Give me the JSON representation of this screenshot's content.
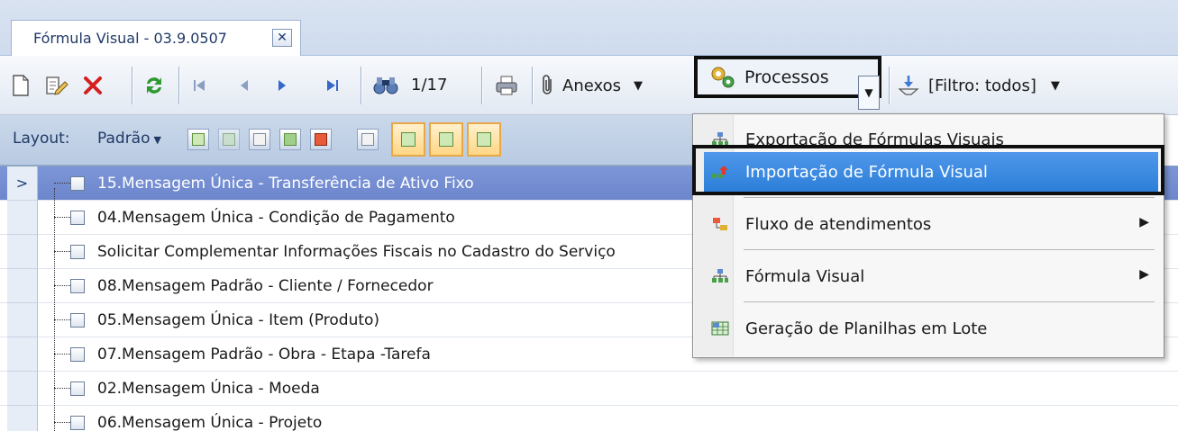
{
  "tab": {
    "title": "Fórmula Visual - 03.9.0507",
    "close": "✕"
  },
  "toolbar": {
    "pager": "1/17",
    "anexos_label": "Anexos",
    "processos_label": "Processos",
    "filtro_label": "[Filtro: todos]"
  },
  "layout_bar": {
    "label": "Layout:",
    "value": "Padrão"
  },
  "rows": [
    "15.Mensagem Única - Transferência de Ativo Fixo",
    "04.Mensagem Única - Condição de Pagamento",
    "Solicitar Complementar Informações Fiscais no Cadastro do Serviço",
    "08.Mensagem Padrão - Cliente / Fornecedor",
    "05.Mensagem Única - Item (Produto)",
    "07.Mensagem Padrão -  Obra - Etapa -Tarefa",
    "02.Mensagem Única - Moeda",
    "06.Mensagem Única - Projeto"
  ],
  "menu": {
    "items": [
      {
        "label": "Exportação de Fórmulas Visuais"
      },
      {
        "label": "Importação de Fórmula Visual"
      },
      {
        "label": "Fluxo de atendimentos"
      },
      {
        "label": "Fórmula Visual"
      },
      {
        "label": "Geração de Planilhas em Lote"
      }
    ]
  },
  "icons": {
    "new": "new-document-icon",
    "edit": "edit-icon",
    "delete": "delete-icon",
    "refresh": "refresh-icon",
    "first": "first-record-icon",
    "prev": "previous-record-icon",
    "next": "next-record-icon",
    "last": "last-record-icon",
    "find": "binoculars-icon",
    "print": "print-icon",
    "attach": "paperclip-icon",
    "process": "gears-icon",
    "filter": "filter-icon"
  },
  "colors": {
    "selection": "#7d96d8",
    "menu_highlight": "#3a87e0",
    "refresh_green": "#2f9a2f",
    "delete_red": "#d42020"
  }
}
